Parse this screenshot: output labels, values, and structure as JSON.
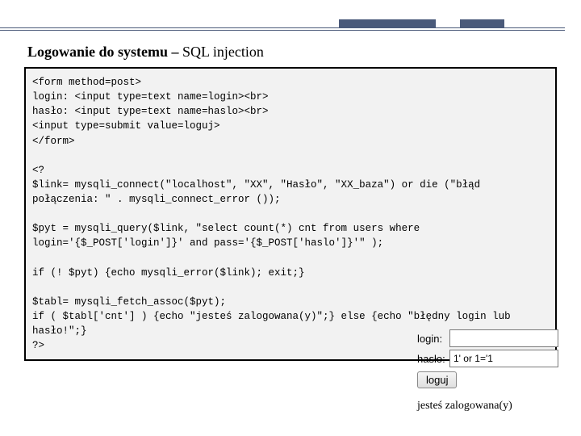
{
  "heading": {
    "bold": "Logowanie do systemu – ",
    "rest": "SQL injection"
  },
  "code": "<form method=post>\nlogin: <input type=text name=login><br>\nhasło: <input type=text name=haslo><br>\n<input type=submit value=loguj>\n</form>\n\n<?\n$link= mysqli_connect(\"localhost\", \"XX\", \"Hasło\", \"XX_baza\") or die (\"błąd połączenia: \" . mysqli_connect_error ());\n\n$pyt = mysqli_query($link, \"select count(*) cnt from users where login='{$_POST['login']}' and pass='{$_POST['haslo']}'\" );\n\nif (! $pyt) {echo mysqli_error($link); exit;}\n\n$tabl= mysqli_fetch_assoc($pyt);\nif ( $tabl['cnt'] ) {echo \"jesteś zalogowana(y)\";} else {echo \"błędny login lub hasło!\";}\n?>",
  "form": {
    "login_label": "login:",
    "haslo_label": "hasło:",
    "login_value": "",
    "haslo_value": "1' or 1='1",
    "submit_label": "loguj",
    "status": "jesteś zalogowana(y)"
  }
}
